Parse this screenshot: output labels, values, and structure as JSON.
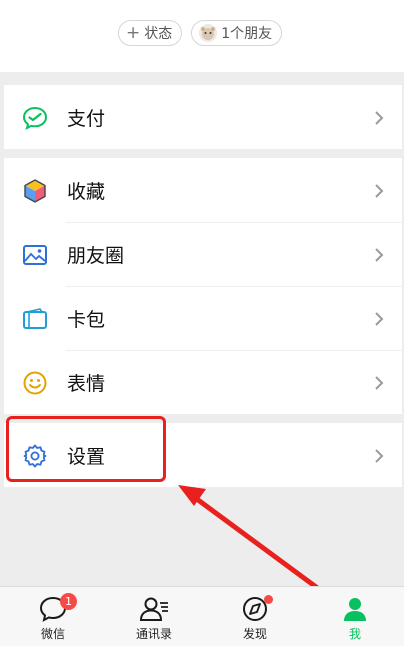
{
  "header": {
    "status_label": "状态",
    "friends_label": "1个朋友"
  },
  "menu": {
    "pay": "支付",
    "favorites": "收藏",
    "moments": "朋友圈",
    "cards": "卡包",
    "stickers": "表情",
    "settings": "设置"
  },
  "tabbar": {
    "chats": "微信",
    "chats_badge": "1",
    "contacts": "通讯录",
    "discover": "发现",
    "me": "我"
  },
  "colors": {
    "accent_green": "#07c160",
    "badge_red": "#f54a45",
    "annotation_red": "#e8211f"
  },
  "icons": {
    "pay": "wechat-pay-icon",
    "favorites": "cube-icon",
    "moments": "picture-icon",
    "cards": "card-wallet-icon",
    "stickers": "smiley-icon",
    "settings": "gear-icon"
  }
}
